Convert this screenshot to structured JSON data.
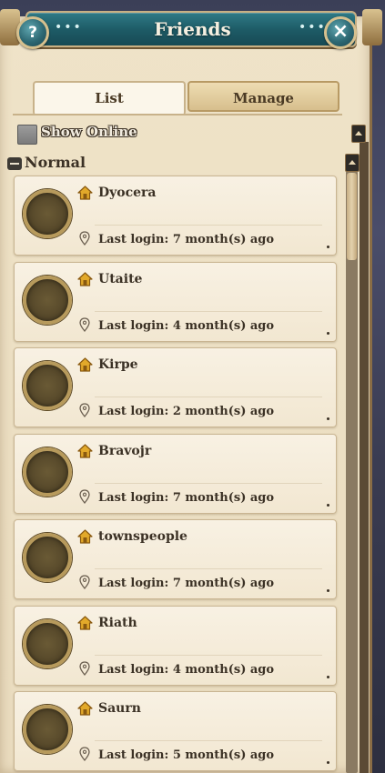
{
  "window": {
    "title": "Friends",
    "help_icon": "?",
    "close_icon": "×",
    "dots": "•••"
  },
  "tabs": [
    {
      "label": "List",
      "active": true
    },
    {
      "label": "Manage",
      "active": false
    }
  ],
  "filter": {
    "show_online_label": "Show Online",
    "checked": false
  },
  "group": {
    "label": "Normal",
    "icon": "collapse-minus"
  },
  "friends": [
    {
      "name": "Dyocera",
      "last_login": "Last login: 7 month(s) ago"
    },
    {
      "name": "Utaite",
      "last_login": "Last login: 4 month(s) ago"
    },
    {
      "name": "Kirpe",
      "last_login": "Last login: 2 month(s) ago"
    },
    {
      "name": "Bravojr",
      "last_login": "Last login: 7 month(s) ago"
    },
    {
      "name": "townspeople",
      "last_login": "Last login: 7 month(s) ago"
    },
    {
      "name": "Riath",
      "last_login": "Last login: 4 month(s) ago"
    },
    {
      "name": "Saurn",
      "last_login": "Last login: 5 month(s) ago"
    }
  ],
  "colors": {
    "title_bar": "#1e5c67",
    "parchment": "#efe3c8",
    "text_dark": "#3b3125",
    "home_icon": "#e2a92a"
  }
}
